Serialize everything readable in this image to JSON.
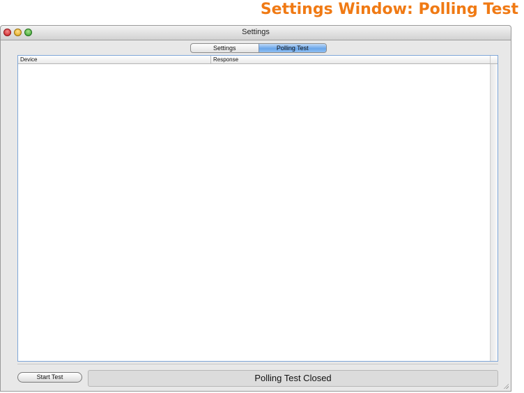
{
  "doc_title": "Settings Window: Polling Test",
  "window": {
    "title": "Settings",
    "controls": [
      "close",
      "minimize",
      "zoom"
    ]
  },
  "tabs": {
    "items": [
      {
        "label": "Settings"
      },
      {
        "label": "Polling Test"
      }
    ],
    "selected": "Polling Test"
  },
  "table": {
    "columns": [
      "Device",
      "Response"
    ],
    "rows": []
  },
  "footer": {
    "start_button": "Start Test",
    "status": "Polling Test Closed"
  },
  "colors": {
    "doc_title": "#f07a14",
    "selected_tab": "#6aa6ea",
    "table_border": "#7ea6d8"
  }
}
